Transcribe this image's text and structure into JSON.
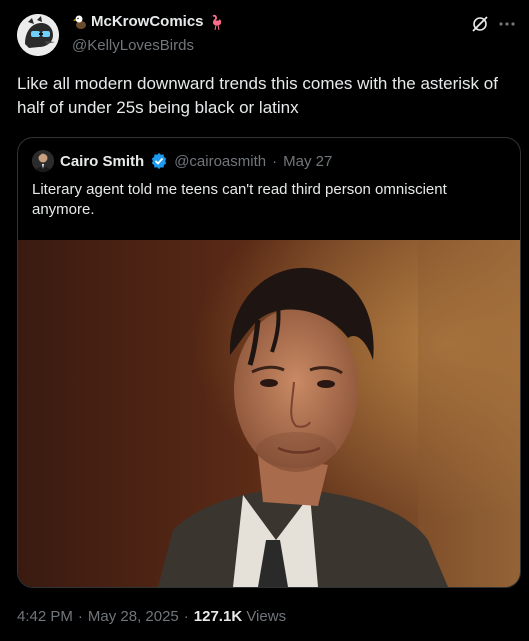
{
  "author": {
    "display_name": "McKrowComics",
    "handle": "@KellyLovesBirds",
    "avatar_icon": "crow-avatar-icon",
    "name_emojis": [
      "eagle-emoji-icon",
      "flamingo-emoji-icon"
    ]
  },
  "toolbar": {
    "grok_icon": "grok-icon",
    "more_icon": "more-options-icon"
  },
  "tweet": {
    "text": "Like all modern downward trends this comes with the asterisk of half of under 25s being black or latinx"
  },
  "quoted_tweet": {
    "display_name": "Cairo Smith",
    "handle": "@cairoasmith",
    "separator": "·",
    "date": "May 27",
    "text": "Literary agent told me teens can't read third person omniscient anymore.",
    "media_alt_icon": "photo-man-in-suit"
  },
  "meta": {
    "time": "4:42 PM",
    "sep1": "·",
    "date": "May 28, 2025",
    "sep2": "·",
    "views_count": "127.1K",
    "views_label": "Views"
  },
  "colors": {
    "background": "#000000",
    "text_primary": "#e7e9ea",
    "text_secondary": "#71767b",
    "border": "#2f3336",
    "verified_blue": "#1d9bf0"
  }
}
